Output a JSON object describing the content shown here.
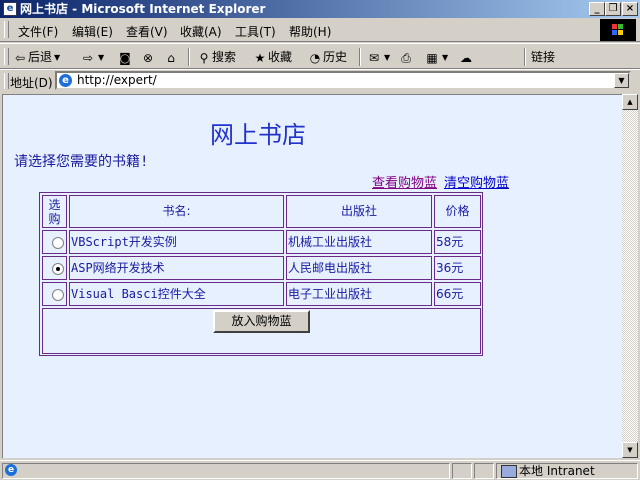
{
  "window": {
    "title": "网上书店 - Microsoft Internet Explorer"
  },
  "menu": [
    "文件(F)",
    "编辑(E)",
    "查看(V)",
    "收藏(A)",
    "工具(T)",
    "帮助(H)"
  ],
  "toolbar": {
    "back": "后退",
    "search": "搜索",
    "favorites": "收藏",
    "history": "历史",
    "links": "链接"
  },
  "address": {
    "label": "地址(D)",
    "url": "http://expert/"
  },
  "page": {
    "title": "网上书店",
    "prompt": "请选择您需要的书籍!",
    "view_cart": "查看购物蓝",
    "clear_cart": "清空购物蓝",
    "table": {
      "headers": [
        "选购",
        "书名:",
        "出版社",
        "价格"
      ],
      "rows": [
        {
          "selected": false,
          "title": "VBScript开发实例",
          "publisher": "机械工业出版社",
          "price": "58元"
        },
        {
          "selected": true,
          "title": "ASP网络开发技术",
          "publisher": "人民邮电出版社",
          "price": "36元"
        },
        {
          "selected": false,
          "title": "Visual Basci控件大全",
          "publisher": "电子工业出版社",
          "price": "66元"
        }
      ]
    },
    "add_button": "放入购物蓝"
  },
  "status": {
    "zone": "本地 Intranet"
  }
}
